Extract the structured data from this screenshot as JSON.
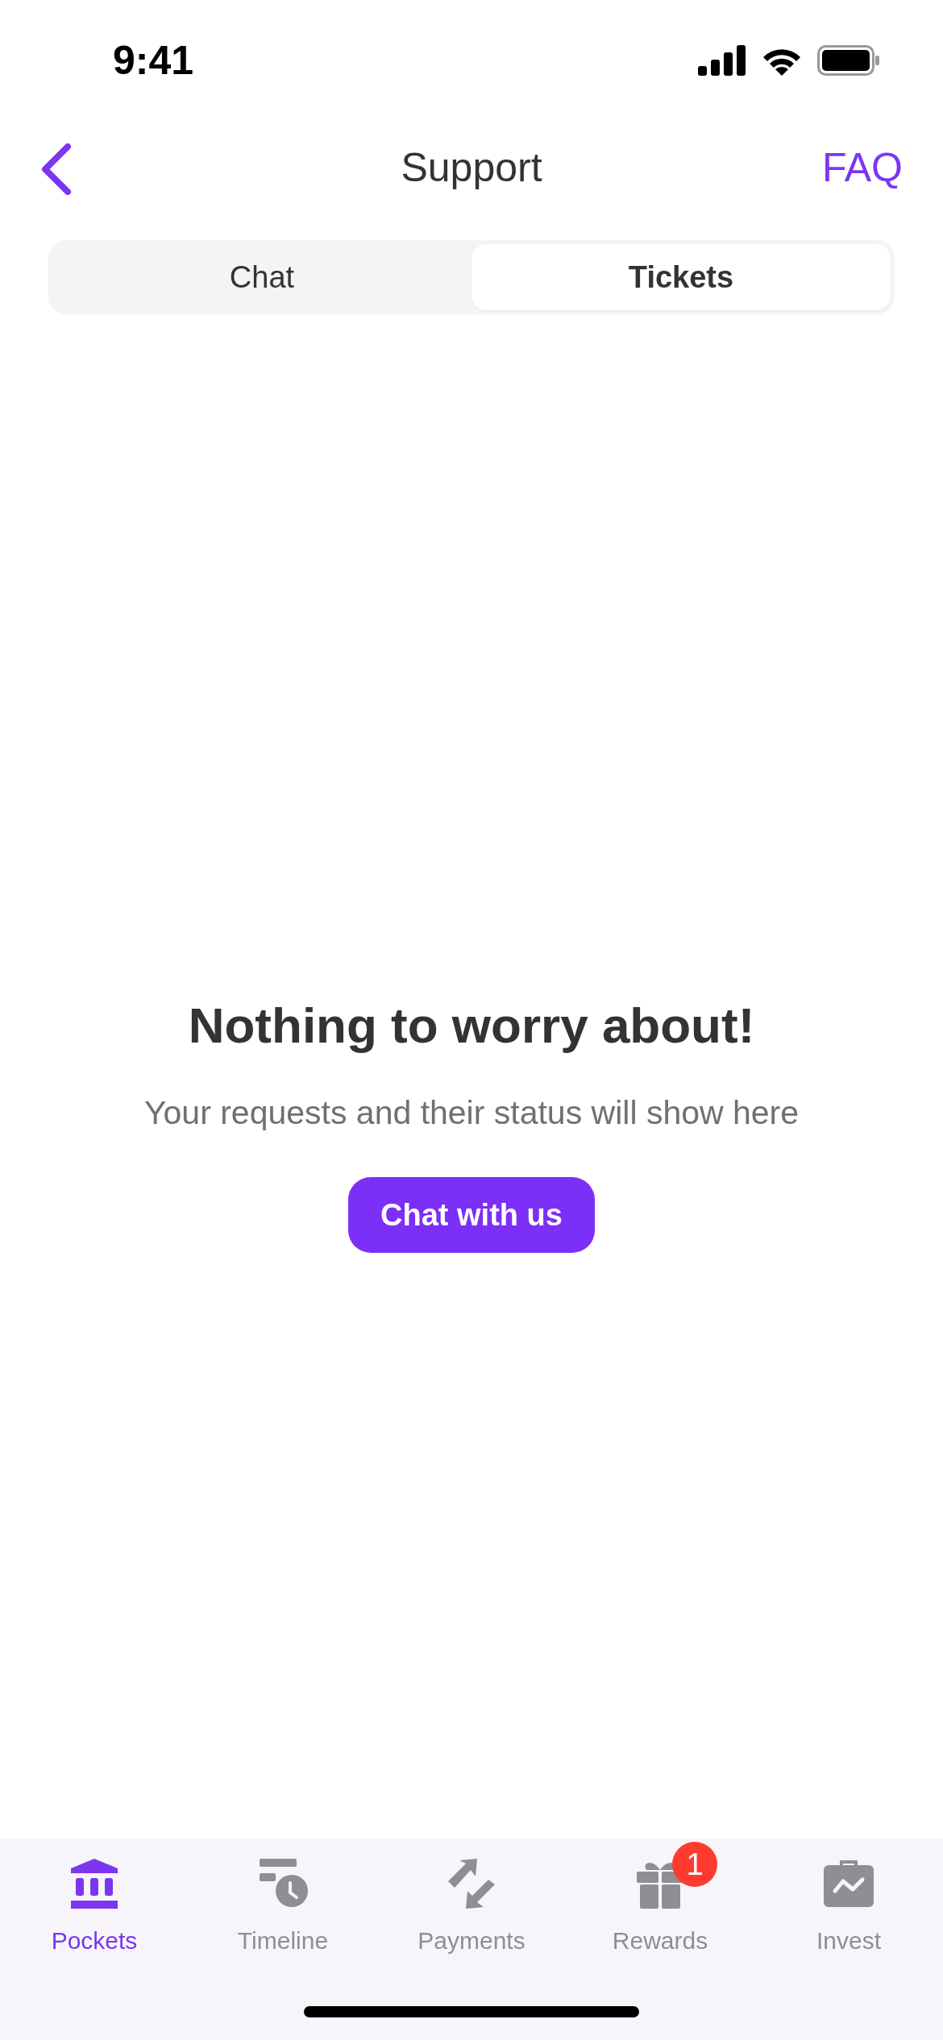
{
  "status_bar": {
    "time": "9:41"
  },
  "nav": {
    "title": "Support",
    "action": "FAQ"
  },
  "tabs": [
    {
      "label": "Chat",
      "selected": false
    },
    {
      "label": "Tickets",
      "selected": true
    }
  ],
  "empty_state": {
    "title": "Nothing to worry about!",
    "message": "Your requests and their status will show here",
    "button": "Chat with us"
  },
  "tab_bar": [
    {
      "kind": "pockets",
      "label": "Pockets",
      "selected": true
    },
    {
      "kind": "timeline",
      "label": "Timeline",
      "selected": false
    },
    {
      "kind": "payments",
      "label": "Payments",
      "selected": false
    },
    {
      "kind": "rewards",
      "label": "Rewards",
      "selected": false,
      "badge": "1"
    },
    {
      "kind": "invest",
      "label": "Invest",
      "selected": false
    }
  ]
}
